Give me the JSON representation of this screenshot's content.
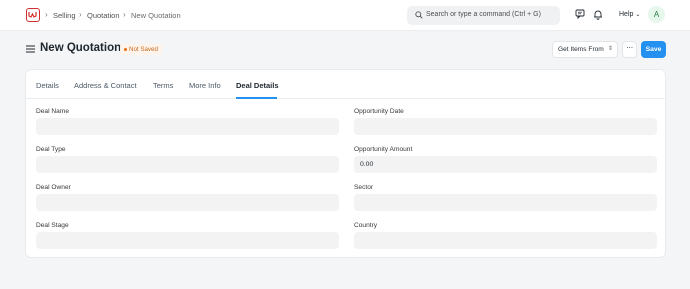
{
  "breadcrumbs": [
    "Selling",
    "Quotation",
    "New Quotation"
  ],
  "search": {
    "placeholder": "Search or type a command (Ctrl + G)"
  },
  "help": {
    "label": "Help"
  },
  "user": {
    "initial": "A"
  },
  "page": {
    "title": "New Quotation",
    "status": "Not Saved"
  },
  "actions": {
    "get_items_from": "Get Items From",
    "more": "···",
    "save": "Save"
  },
  "tabs": [
    {
      "label": "Details"
    },
    {
      "label": "Address & Contact"
    },
    {
      "label": "Terms"
    },
    {
      "label": "More Info"
    },
    {
      "label": "Deal Details",
      "active": true
    }
  ],
  "fields": {
    "left": [
      {
        "label": "Deal Name",
        "value": ""
      },
      {
        "label": "Deal Type",
        "value": ""
      },
      {
        "label": "Deal Owner",
        "value": ""
      },
      {
        "label": "Deal Stage",
        "value": ""
      }
    ],
    "right": [
      {
        "label": "Opportunity Date",
        "value": ""
      },
      {
        "label": "Opportunity Amount",
        "value": "0.00"
      },
      {
        "label": "Sector",
        "value": ""
      },
      {
        "label": "Country",
        "value": ""
      }
    ]
  },
  "colors": {
    "primary": "#2490ef",
    "logo": "#d32f2f",
    "status_text": "#c26a1e",
    "status_bg": "#fff4ec"
  },
  "icons": [
    "app-logo-icon",
    "chevron-right-icon",
    "search-icon",
    "chat-icon",
    "bell-icon",
    "chevron-down-icon",
    "hamburger-menu-icon",
    "updown-chevron-icon"
  ]
}
